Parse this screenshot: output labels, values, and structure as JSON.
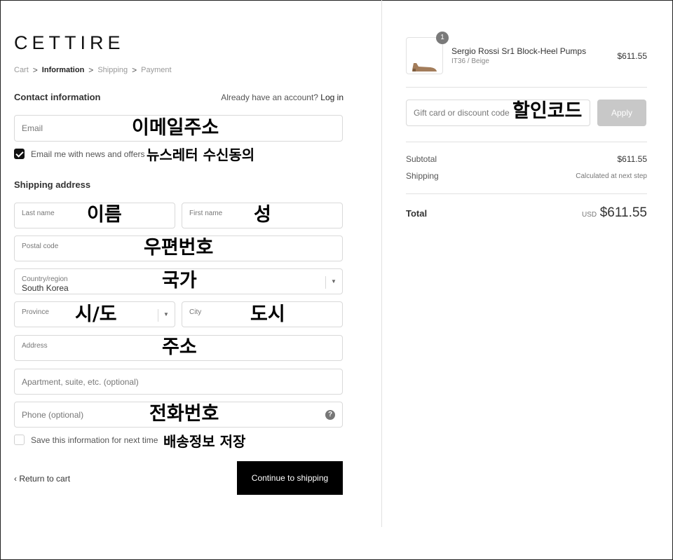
{
  "brand": {
    "logo": "CETTIRE"
  },
  "breadcrumb": {
    "items": [
      {
        "label": "Cart"
      },
      {
        "label": "Information"
      },
      {
        "label": "Shipping"
      },
      {
        "label": "Payment"
      }
    ],
    "separator": ">"
  },
  "contact": {
    "title": "Contact information",
    "account_prompt": "Already have an account?",
    "login_label": "Log in",
    "email_placeholder": "Email",
    "email_annotation": "이메일주소",
    "newsletter_label": "Email me with news and offers",
    "newsletter_checked": true,
    "newsletter_annotation": "뉴스레터 수신동의"
  },
  "shipping": {
    "title": "Shipping address",
    "last_name_label": "Last name",
    "last_name_annotation": "이름",
    "first_name_label": "First name",
    "first_name_annotation": "성",
    "postal_label": "Postal code",
    "postal_annotation": "우편번호",
    "country_label": "Country/region",
    "country_value": "South Korea",
    "country_annotation": "국가",
    "province_label": "Province",
    "province_annotation": "시/도",
    "city_label": "City",
    "city_annotation": "도시",
    "address_label": "Address",
    "address_annotation": "주소",
    "apartment_placeholder": "Apartment, suite, etc. (optional)",
    "phone_placeholder": "Phone (optional)",
    "phone_annotation": "전화번호",
    "save_info_label": "Save this information for next time",
    "save_info_checked": false,
    "save_info_annotation": "배송정보 저장"
  },
  "actions": {
    "return_label": "Return to cart",
    "continue_label": "Continue to shipping"
  },
  "order": {
    "quantity": "1",
    "product_name": "Sergio Rossi Sr1 Block-Heel Pumps",
    "variant": "IT36 / Beige",
    "price": "$611.55",
    "discount_placeholder": "Gift card or discount code",
    "discount_annotation": "할인코드",
    "apply_label": "Apply",
    "subtotal_label": "Subtotal",
    "subtotal_value": "$611.55",
    "shipping_label": "Shipping",
    "shipping_value": "Calculated at next step",
    "total_label": "Total",
    "currency": "USD",
    "total_value": "$611.55"
  },
  "colors": {
    "primary_button": "#000000",
    "apply_disabled": "#c8c8c8",
    "border": "#d9d9d9"
  },
  "icons": [
    "chevron-right-icon",
    "chevron-left-icon",
    "dropdown-caret-icon",
    "help-icon",
    "checkmark-icon",
    "shoe-thumbnail"
  ]
}
